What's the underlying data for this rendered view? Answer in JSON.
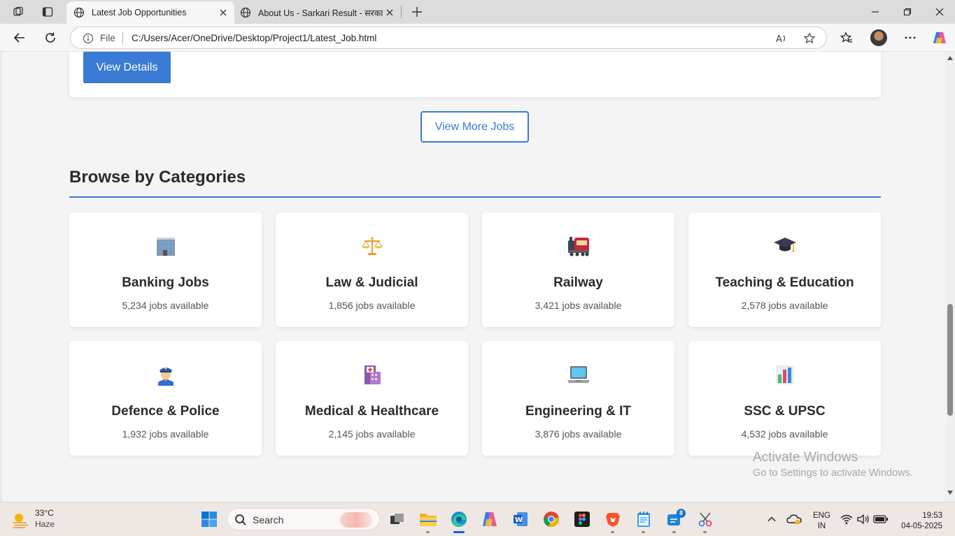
{
  "browser": {
    "tabs": [
      {
        "title": "Latest Job Opportunities",
        "active": true
      },
      {
        "title": "About Us - Sarkari Result - सरकारी",
        "active": false
      }
    ],
    "address": {
      "scheme_label": "File",
      "url": "C:/Users/Acer/OneDrive/Desktop/Project1/Latest_Job.html"
    },
    "icons": [
      "workspaces-icon",
      "tab-actions-icon",
      "globe-icon",
      "close-icon",
      "new-tab-icon",
      "minimize-icon",
      "restore-icon",
      "back-icon",
      "refresh-icon",
      "info-icon",
      "read-aloud-icon",
      "favorite-star-icon",
      "favorites-icon",
      "more-icon",
      "copilot-icon"
    ]
  },
  "page": {
    "view_details_label": "View Details",
    "view_more_label": "View More Jobs",
    "section_title": "Browse by Categories",
    "accent_color": "#3a7bd5",
    "categories": [
      {
        "name": "Banking Jobs",
        "count": "5,234 jobs available",
        "icon": "office-building-icon"
      },
      {
        "name": "Law & Judicial",
        "count": "1,856 jobs available",
        "icon": "balance-scale-icon"
      },
      {
        "name": "Railway",
        "count": "3,421 jobs available",
        "icon": "train-icon"
      },
      {
        "name": "Teaching & Education",
        "count": "2,578 jobs available",
        "icon": "graduation-cap-icon"
      },
      {
        "name": "Defence & Police",
        "count": "1,932 jobs available",
        "icon": "police-officer-icon"
      },
      {
        "name": "Medical & Healthcare",
        "count": "2,145 jobs available",
        "icon": "hospital-icon"
      },
      {
        "name": "Engineering & IT",
        "count": "3,876 jobs available",
        "icon": "laptop-icon"
      },
      {
        "name": "SSC & UPSC",
        "count": "4,532 jobs available",
        "icon": "bar-chart-icon"
      }
    ],
    "watermark": {
      "line1": "Activate Windows",
      "line2": "Go to Settings to activate Windows."
    }
  },
  "taskbar": {
    "weather": {
      "temp": "33°C",
      "condition": "Haze"
    },
    "search_placeholder": "Search",
    "lang": {
      "line1": "ENG",
      "line2": "IN"
    },
    "clock": {
      "time": "19:53",
      "date": "04-05-2025"
    },
    "notification_badge": "8"
  }
}
